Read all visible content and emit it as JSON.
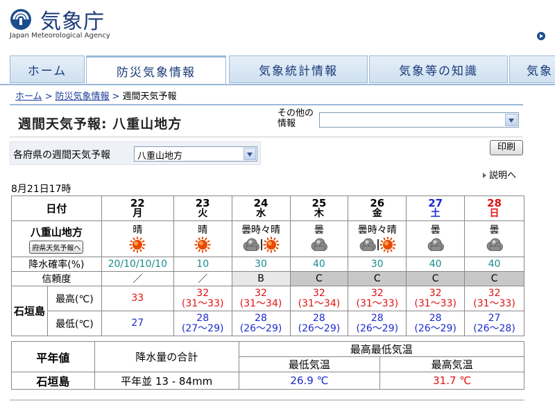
{
  "header": {
    "title": "気象庁",
    "subtitle": "Japan Meteorological Agency"
  },
  "nav": {
    "tabs": [
      {
        "label": "ホーム",
        "active": false
      },
      {
        "label": "防災気象情報",
        "active": true
      },
      {
        "label": "気象統計情報",
        "active": false
      },
      {
        "label": "気象等の知識",
        "active": false
      },
      {
        "label": "気象",
        "active": false
      }
    ]
  },
  "breadcrumb": {
    "items": [
      "ホーム",
      "防災気象情報"
    ],
    "current": "週間天気予報",
    "separator": ">"
  },
  "title": "週間天気予報: 八重山地方",
  "other_info": {
    "label": "その他の情報",
    "value": ""
  },
  "pref_select": {
    "label": "各府県の週間天気予報",
    "value": "八重山地方"
  },
  "print_label": "印刷",
  "explain_label": "説明へ",
  "issued": "8月21日17時",
  "forecast": {
    "date_header": "日付",
    "region": "八重山地方",
    "pref_button": "府県天気予報へ",
    "pop_label": "降水確率(%)",
    "reliability_label": "信頼度",
    "station": "石垣島",
    "max_label": "最高(℃)",
    "min_label": "最低(℃)",
    "days": [
      {
        "date": "22",
        "dow": "月",
        "day_type": "weekday",
        "weather": "晴",
        "icons": [
          "sun-icon"
        ],
        "pop": "20/10/10/10",
        "reliability": "／",
        "rel_bg": "none",
        "max": "33",
        "max_range": "",
        "min": "27",
        "min_range": ""
      },
      {
        "date": "23",
        "dow": "火",
        "day_type": "weekday",
        "weather": "晴",
        "icons": [
          "sun-icon"
        ],
        "pop": "10",
        "reliability": "／",
        "rel_bg": "none",
        "max": "32",
        "max_range": "(31～33)",
        "min": "28",
        "min_range": "(27～29)"
      },
      {
        "date": "24",
        "dow": "水",
        "day_type": "weekday",
        "weather": "曇時々晴",
        "icons": [
          "cloud-icon",
          "sun-icon"
        ],
        "pop": "30",
        "reliability": "B",
        "rel_bg": "light",
        "max": "32",
        "max_range": "(31～34)",
        "min": "28",
        "min_range": "(26～29)"
      },
      {
        "date": "25",
        "dow": "木",
        "day_type": "weekday",
        "weather": "曇",
        "icons": [
          "cloud-icon"
        ],
        "pop": "40",
        "reliability": "C",
        "rel_bg": "dark",
        "max": "32",
        "max_range": "(31～34)",
        "min": "28",
        "min_range": "(26～29)"
      },
      {
        "date": "26",
        "dow": "金",
        "day_type": "weekday",
        "weather": "曇時々晴",
        "icons": [
          "cloud-icon",
          "sun-icon"
        ],
        "pop": "30",
        "reliability": "C",
        "rel_bg": "dark",
        "max": "32",
        "max_range": "(31～33)",
        "min": "28",
        "min_range": "(26～29)"
      },
      {
        "date": "27",
        "dow": "土",
        "day_type": "saturday",
        "weather": "曇",
        "icons": [
          "cloud-icon"
        ],
        "pop": "40",
        "reliability": "C",
        "rel_bg": "dark",
        "max": "32",
        "max_range": "(31～33)",
        "min": "28",
        "min_range": "(26～29)"
      },
      {
        "date": "28",
        "dow": "日",
        "day_type": "sunday",
        "weather": "曇",
        "icons": [
          "cloud-icon"
        ],
        "pop": "40",
        "reliability": "C",
        "rel_bg": "dark",
        "max": "32",
        "max_range": "(31～33)",
        "min": "27",
        "min_range": "(26～28)"
      }
    ]
  },
  "normals": {
    "header": "平年値",
    "precip_header": "降水量の合計",
    "temp_header": "最高最低気温",
    "min_header": "最低気温",
    "max_header": "最高気温",
    "station": "石垣島",
    "precip_value": "平年並 13 - 84mm",
    "min_value": "26.9 ℃",
    "max_value": "31.7 ℃"
  },
  "colors": {
    "brand": "#1a3a7a",
    "max_temp": "#e01010",
    "min_temp": "#1a2ad0",
    "pop": "#1a8a8a",
    "sun": "#e84a00",
    "cloud": "#8c8c8c"
  }
}
